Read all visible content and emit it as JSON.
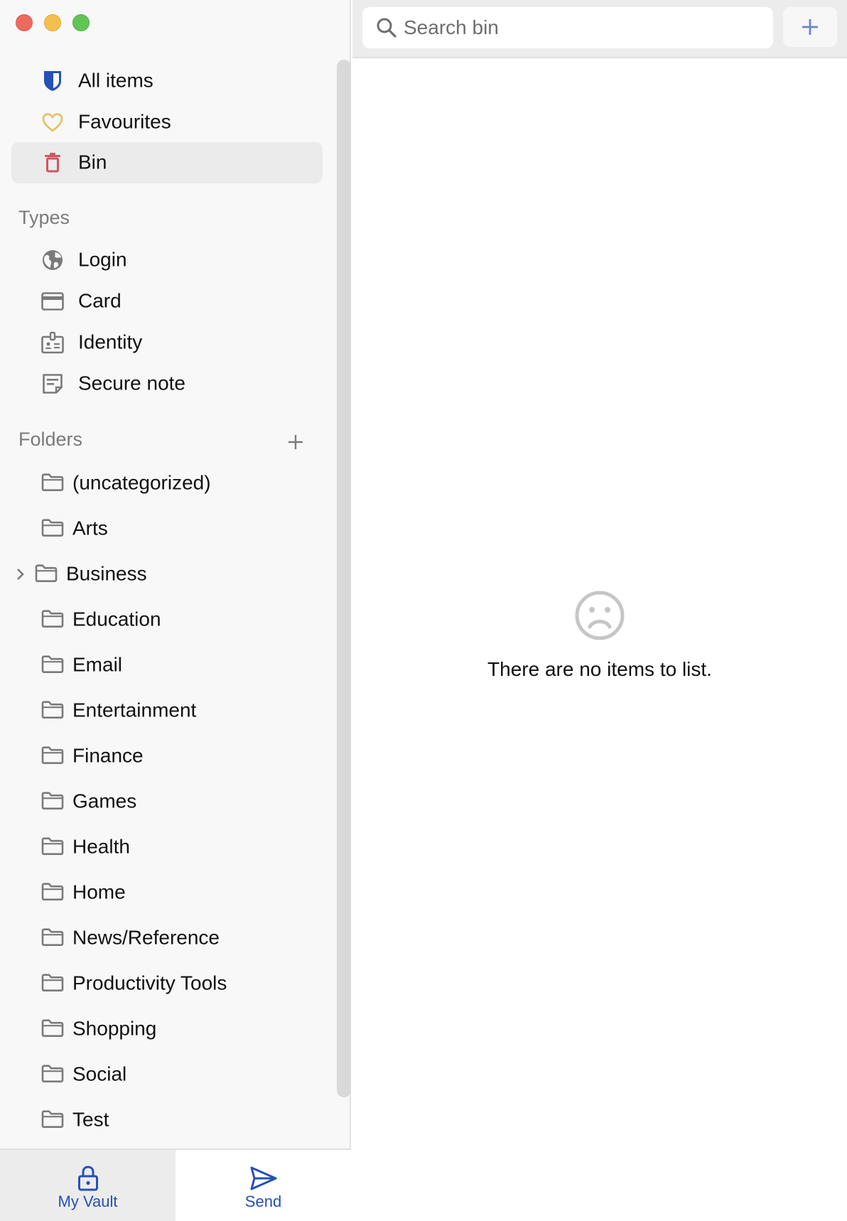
{
  "window": {
    "traffic_lights": [
      "close",
      "minimize",
      "zoom"
    ]
  },
  "sidebar": {
    "primary": [
      {
        "label": "All items",
        "icon": "shield-icon",
        "color": "#2550b8",
        "active": false
      },
      {
        "label": "Favourites",
        "icon": "heart-icon",
        "color": "#ecbd5b",
        "active": false
      },
      {
        "label": "Bin",
        "icon": "trash-icon",
        "color": "#cf5561",
        "active": true
      }
    ],
    "types_heading": "Types",
    "types": [
      {
        "label": "Login",
        "icon": "globe-icon"
      },
      {
        "label": "Card",
        "icon": "credit-card-icon"
      },
      {
        "label": "Identity",
        "icon": "id-card-icon"
      },
      {
        "label": "Secure note",
        "icon": "note-icon"
      }
    ],
    "folders_heading": "Folders",
    "folders_add_icon": "plus-icon",
    "folders": [
      {
        "label": "(uncategorized)",
        "expandable": false
      },
      {
        "label": "Arts",
        "expandable": false
      },
      {
        "label": "Business",
        "expandable": true
      },
      {
        "label": "Education",
        "expandable": false
      },
      {
        "label": "Email",
        "expandable": false
      },
      {
        "label": "Entertainment",
        "expandable": false
      },
      {
        "label": "Finance",
        "expandable": false
      },
      {
        "label": "Games",
        "expandable": false
      },
      {
        "label": "Health",
        "expandable": false
      },
      {
        "label": "Home",
        "expandable": false
      },
      {
        "label": "News/Reference",
        "expandable": false
      },
      {
        "label": "Productivity Tools",
        "expandable": false
      },
      {
        "label": "Shopping",
        "expandable": false
      },
      {
        "label": "Social",
        "expandable": false
      },
      {
        "label": "Test",
        "expandable": false
      }
    ]
  },
  "tabbar": {
    "tabs": [
      {
        "label": "My Vault",
        "icon": "lock-icon",
        "active": true
      },
      {
        "label": "Send",
        "icon": "send-icon",
        "active": false
      }
    ],
    "accent": "#2550b8"
  },
  "main": {
    "search": {
      "placeholder": "Search bin",
      "value": ""
    },
    "add_icon": "plus-icon",
    "empty_state": {
      "icon": "frown-icon",
      "message": "There are no items to list."
    }
  }
}
